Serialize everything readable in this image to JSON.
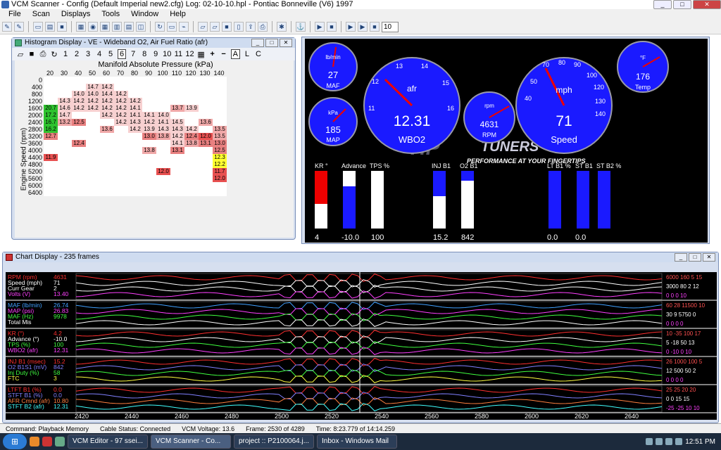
{
  "window": {
    "title": "VCM Scanner  -  Config  (Default Imperial new2.cfg)    Log:  02-10-10.hpl    -  Pontiac Bonneville (V6) 1997"
  },
  "menu": [
    "File",
    "Scan",
    "Displays",
    "Tools",
    "Window",
    "Help"
  ],
  "toolbar": {
    "spin_value": "10"
  },
  "histogram": {
    "title": "Histogram Display  -  VE - Wideband O2,  Air Fuel Ratio  (afr)",
    "tool_buttons": [
      "1",
      "2",
      "3",
      "4",
      "5",
      "6",
      "7",
      "8",
      "9",
      "10",
      "11",
      "12"
    ],
    "selected": "6",
    "letters": [
      "+",
      "−",
      "A",
      "L",
      "C"
    ],
    "x_title": "Manifold Absolute Pressure (kPa)",
    "y_title": "Engine Speed (rpm)",
    "columns": [
      "20",
      "30",
      "40",
      "50",
      "60",
      "70",
      "80",
      "90",
      "100",
      "110",
      "120",
      "130",
      "140"
    ],
    "rows": [
      {
        "rpm": "0",
        "cells": [
          "",
          "",
          "",
          "",
          "",
          "",
          "",
          "",
          "",
          "",
          "",
          "",
          ""
        ]
      },
      {
        "rpm": "400",
        "cells": [
          "",
          "",
          "",
          "14.7",
          "14.2",
          "",
          "",
          "",
          "",
          "",
          "",
          "",
          ""
        ]
      },
      {
        "rpm": "800",
        "cells": [
          "",
          "",
          "14.0",
          "14.0",
          "14.4",
          "14.2",
          "",
          "",
          "",
          "",
          "",
          "",
          ""
        ]
      },
      {
        "rpm": "1200",
        "cells": [
          "",
          "14.3",
          "14.2",
          "14.2",
          "14.2",
          "14.2",
          "14.2",
          "",
          "",
          "",
          "",
          "",
          ""
        ]
      },
      {
        "rpm": "1600",
        "cells": [
          "20.7",
          "14.6",
          "14.2",
          "14.2",
          "14.2",
          "14.2",
          "14.1",
          "",
          "",
          "13.7",
          "13.9",
          "",
          ""
        ]
      },
      {
        "rpm": "2000",
        "cells": [
          "17.2",
          "14.7",
          "",
          "",
          "14.2",
          "14.2",
          "14.1",
          "14.1",
          "14.0",
          "",
          "",
          "",
          ""
        ]
      },
      {
        "rpm": "2400",
        "cells": [
          "16.7",
          "13.2",
          "12.5",
          "",
          "",
          "14.2",
          "14.3",
          "14.2",
          "14.1",
          "14.5",
          "",
          "13.6",
          ""
        ]
      },
      {
        "rpm": "2800",
        "cells": [
          "16.2",
          "",
          "",
          "",
          "13.6",
          "",
          "14.2",
          "13.9",
          "14.3",
          "14.3",
          "14.2",
          "",
          "13.5"
        ]
      },
      {
        "rpm": "3200",
        "cells": [
          "12.7",
          "",
          "",
          "",
          "",
          "",
          "",
          "13.0",
          "13.8",
          "14.2",
          "12.4",
          "12.0",
          "13.5"
        ]
      },
      {
        "rpm": "3600",
        "cells": [
          "",
          "",
          "12.4",
          "",
          "",
          "",
          "",
          "",
          "",
          "14.1",
          "13.8",
          "13.1",
          "13.0"
        ]
      },
      {
        "rpm": "4000",
        "cells": [
          "",
          "",
          "",
          "",
          "",
          "",
          "",
          "13.8",
          "",
          "13.1",
          "",
          "",
          "12.5"
        ]
      },
      {
        "rpm": "4400",
        "cells": [
          "11.9",
          "",
          "",
          "",
          "",
          "",
          "",
          "",
          "",
          "",
          "",
          "",
          "12.3"
        ]
      },
      {
        "rpm": "4800",
        "cells": [
          "",
          "",
          "",
          "",
          "",
          "",
          "",
          "",
          "",
          "",
          "",
          "",
          "12.2"
        ]
      },
      {
        "rpm": "5200",
        "cells": [
          "",
          "",
          "",
          "",
          "",
          "",
          "",
          "",
          "12.0",
          "",
          "",
          "",
          "11.7"
        ]
      },
      {
        "rpm": "5600",
        "cells": [
          "",
          "",
          "",
          "",
          "",
          "",
          "",
          "",
          "",
          "",
          "",
          "",
          "12.0"
        ]
      },
      {
        "rpm": "6000",
        "cells": [
          "",
          "",
          "",
          "",
          "",
          "",
          "",
          "",
          "",
          "",
          "",
          "",
          ""
        ]
      },
      {
        "rpm": "6400",
        "cells": [
          "",
          "",
          "",
          "",
          "",
          "",
          "",
          "",
          "",
          "",
          "",
          "",
          ""
        ]
      }
    ]
  },
  "gauges": {
    "maf": {
      "unit": "lb/min",
      "label": "MAF",
      "value": "27"
    },
    "map": {
      "unit": "kPa",
      "label": "MAP",
      "value": "185"
    },
    "afr": {
      "unit": "afr",
      "label": "WBO2",
      "value": "12.31"
    },
    "rpm": {
      "unit": "rpm",
      "label": "RPM",
      "value": "4631"
    },
    "speed": {
      "unit": "mph",
      "label": "Speed",
      "value": "71"
    },
    "temp": {
      "unit": "°F",
      "label": "Temp",
      "value": "176"
    },
    "brand": "TUNERS",
    "tagline": "PERFORMANCE AT YOUR FINGERTIPS",
    "bars": [
      {
        "name": "KR °",
        "value": "4"
      },
      {
        "name": "Advance",
        "value": "-10.0"
      },
      {
        "name": "TPS %",
        "value": "100"
      },
      {
        "name": "INJ B1",
        "value": "15.2"
      },
      {
        "name": "O2 B1",
        "value": "842"
      },
      {
        "name": "LT B1 %",
        "value": "0.0"
      },
      {
        "name": "ST B1",
        "value": "0.0"
      },
      {
        "name": "ST B2 %",
        "value": ""
      }
    ]
  },
  "chart": {
    "title": "Chart Display  -  235 frames",
    "x_ticks": [
      "2420",
      "2440",
      "2460",
      "2480",
      "2500",
      "2520",
      "2540",
      "2560",
      "2580",
      "2600",
      "2620",
      "2640"
    ],
    "panels": [
      {
        "items": [
          {
            "name": "RPM (rpm)",
            "value": "4631",
            "color": "#ff3030"
          },
          {
            "name": "Speed (mph)",
            "value": "71",
            "color": "#ffffff"
          },
          {
            "name": "Curr Gear",
            "value": "2",
            "color": "#ffffff"
          },
          {
            "name": "Volts (V)",
            "value": "13.40",
            "color": "#ff40ff"
          }
        ],
        "scale": [
          "6000  160  5  15",
          "3000  80   2  12",
          "0     0    0  10"
        ]
      },
      {
        "items": [
          {
            "name": "MAF (lb/min)",
            "value": "26.74",
            "color": "#40a0ff"
          },
          {
            "name": "MAP (psi)",
            "value": "26.83",
            "color": "#ff40ff"
          },
          {
            "name": "MAF (Hz)",
            "value": "9978",
            "color": "#40ff40"
          },
          {
            "name": "Total Mis",
            "value": "",
            "color": "#ffffff"
          }
        ],
        "scale": [
          "60  28  11500  10",
          "30  9   5750   0",
          "0   0   0      0"
        ]
      },
      {
        "items": [
          {
            "name": "KR (°)",
            "value": "4.2",
            "color": "#ff3030"
          },
          {
            "name": "Advance (°)",
            "value": "-10.0",
            "color": "#ffffff"
          },
          {
            "name": "TPS (%)",
            "value": "100",
            "color": "#40ff40"
          },
          {
            "name": "WBO2 (afr)",
            "value": "12.31",
            "color": "#ff40ff"
          }
        ],
        "scale": [
          "10  -35  100  17",
          "5   -18  50   13",
          "0   -10  0    10"
        ]
      },
      {
        "items": [
          {
            "name": "INJ B1 (msec)",
            "value": "15.2",
            "color": "#ff3030"
          },
          {
            "name": "O2 B1S1 (mV)",
            "value": "842",
            "color": "#8080ff"
          },
          {
            "name": "Inj Duty (%)",
            "value": "58",
            "color": "#40ff40"
          },
          {
            "name": "FTC",
            "value": "3",
            "color": "#ffff40"
          }
        ],
        "scale": [
          "26  1000  100  5",
          "12  500   50   2",
          "0   0     0    0"
        ]
      },
      {
        "items": [
          {
            "name": "LTFT B1 (%)",
            "value": "0.0",
            "color": "#ff3030"
          },
          {
            "name": "STFT B1 (%)",
            "value": "0.0",
            "color": "#8080ff"
          },
          {
            "name": "AFR Cmnd (afr)",
            "value": "10.80",
            "color": "#ff8040"
          },
          {
            "name": "STFT B2 (afr)",
            "value": "12.31",
            "color": "#40ffff"
          }
        ],
        "scale": [
          "25  25  20  20",
          "0   0   15  15",
          "-25 -25 10  10"
        ]
      }
    ]
  },
  "status": {
    "command": "Command:  Playback Memory",
    "cable": "Cable Status:  Connected",
    "voltage": "VCM Voltage:  13.6",
    "frame": "Frame:  2530 of 4289",
    "time": "Time:  8:23.779 of 14:14.259"
  },
  "taskbar": {
    "tasks": [
      "VCM Editor - 97 ssei...",
      "VCM Scanner  -  Co...",
      "project :: P2100064.j...",
      "Inbox - Windows Mail"
    ],
    "clock": "12:51 PM"
  },
  "colors": {
    "panel_bg": "#000000",
    "gauge_face": "#1a1aff",
    "heat_hi": "#e05050",
    "heat_lo": "#f7d0d0"
  }
}
